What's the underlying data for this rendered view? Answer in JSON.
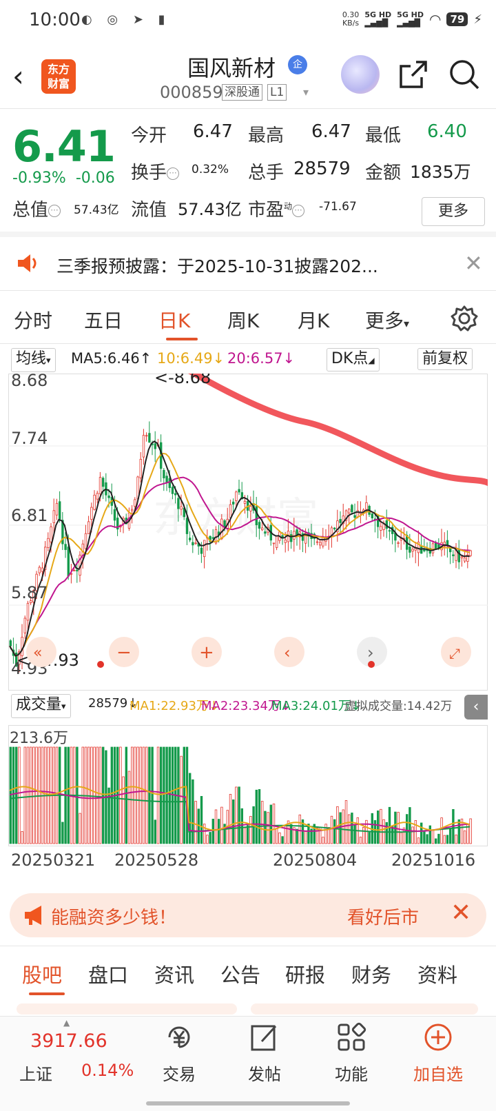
{
  "status": {
    "time": "10:00",
    "speed": "0.30\nKB/s",
    "net1": "5G HD",
    "net2": "5G HD",
    "battery": "79"
  },
  "header": {
    "logo_text_1": "东方",
    "logo_text_2": "财富",
    "stock_name": "国风新材",
    "qi_badge": "企",
    "code": "000859",
    "tag1": "深股通",
    "tag2": "L1"
  },
  "quote": {
    "price": "6.41",
    "change_pct": "-0.93%",
    "change_amt": "-0.06",
    "open_label": "今开",
    "open": "6.47",
    "high_label": "最高",
    "high": "6.47",
    "low_label": "最低",
    "low": "6.40",
    "turnover_label": "换手",
    "turnover": "0.32%",
    "volume_label": "总手",
    "volume": "28579",
    "amount_label": "金额",
    "amount": "1835万",
    "mcap_label": "总值",
    "mcap": "57.43亿",
    "float_label": "流值",
    "float": "57.43亿",
    "pe_label": "市盈",
    "pe_sup": "动",
    "pe": "-71.67",
    "more": "更多"
  },
  "notice": {
    "text": "三季报预披露：于2025-10-31披露202..."
  },
  "tabs": [
    "分时",
    "五日",
    "日K",
    "周K",
    "月K",
    "更多"
  ],
  "ma_bar": {
    "select": "均线",
    "ma5": "MA5:6.46↑",
    "ma10": "10:6.49↓",
    "ma20": "20:6.57↓",
    "dk": "DK点",
    "fq": "前复权"
  },
  "kline": {
    "y_labels": [
      "8.68",
      "7.74",
      "6.81",
      "5.87",
      "4.93"
    ],
    "max_mark": "<-8.68",
    "min_mark": "<--4.93"
  },
  "volume_bar": {
    "select": "成交量",
    "vol": "28579↓",
    "ma1": "MA1:22.93万↓",
    "ma2": "MA2:23.34万↓",
    "ma3": "MA3:24.01万↓",
    "virtual": "虚拟成交量:14.42万",
    "y_label": "213.6万"
  },
  "dates": [
    "20250321",
    "20250528",
    "20250804",
    "20251016"
  ],
  "ad": {
    "left": "能融资多少钱！",
    "right": "看好后市"
  },
  "subtabs": [
    "股吧",
    "盘口",
    "资讯",
    "公告",
    "研报",
    "财务",
    "资料"
  ],
  "bottom": {
    "index_value": "3917.66",
    "index_name": "上证",
    "index_pct": "0.14%",
    "items": [
      "交易",
      "发帖",
      "功能",
      "加自选"
    ]
  },
  "colors": {
    "up": "#e2332a",
    "down": "#149a4b",
    "accent": "#e2532a",
    "ma5": "#222222",
    "ma10": "#e6a817",
    "ma20": "#c0168f"
  },
  "chart_data": {
    "type": "candlestick",
    "y_range": [
      4.93,
      8.68
    ],
    "price_max": 8.68,
    "price_min": 4.93,
    "ma": {
      "MA5": 6.46,
      "MA10": 6.49,
      "MA20": 6.57
    },
    "volume_y_max": "213.6万",
    "x_ticks": [
      "20250321",
      "20250528",
      "20250804",
      "20251016"
    ]
  }
}
